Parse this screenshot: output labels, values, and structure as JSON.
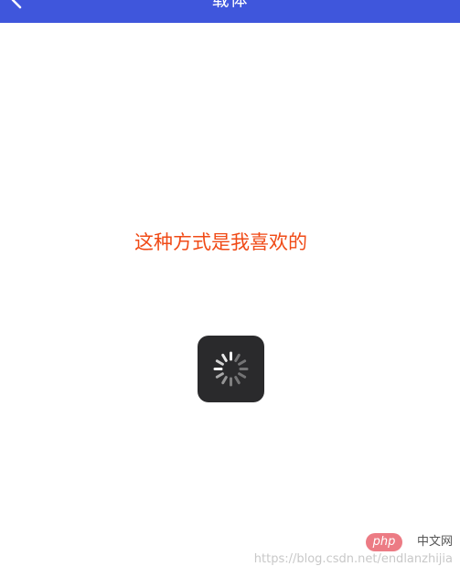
{
  "app_bar": {
    "title": "载体",
    "back_icon": "chevron-left-icon",
    "background": "#3f56dc"
  },
  "content": {
    "message": "这种方式是我喜欢的",
    "message_color": "#f04a16"
  },
  "loading_toast": {
    "icon": "spinner-icon"
  },
  "watermark": {
    "logo_text": "php",
    "site_label": "中文网",
    "url": "https://blog.csdn.net/endlanzhijia"
  }
}
